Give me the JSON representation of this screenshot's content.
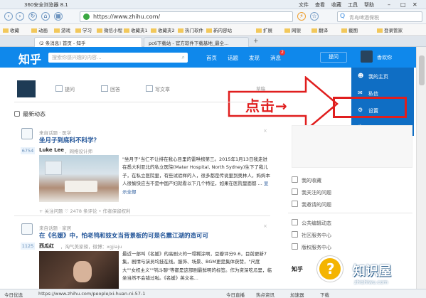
{
  "browser": {
    "title": "360安全浏览器 8.1",
    "menus": [
      "文件",
      "查看",
      "收藏",
      "工具",
      "帮助"
    ],
    "url": "https://www.zhihu.com/",
    "search_placeholder": "青岛啤酒保税",
    "favorites": [
      "收藏",
      "动画",
      "游戏",
      "学习",
      "微信小程",
      "收藏夹1",
      "收藏夹2",
      "热门软件",
      "新内容站",
      "扩展",
      "网银",
      "翻译",
      "截图",
      "登录管家"
    ],
    "tabs": [
      {
        "label": "(2 条消息) 首页 - 知乎",
        "active": true
      },
      {
        "label": "pc6下载站 - 官方软件下载基地_最全...",
        "active": false
      }
    ]
  },
  "zhihu": {
    "logo": "知乎",
    "search_placeholder": "搜索你感兴趣的内容...",
    "nav": [
      "首页",
      "话题",
      "发现",
      "消息"
    ],
    "message_badge": "2",
    "ask_button": "提问",
    "username": "香欢你",
    "menu": [
      {
        "label": "我的主页",
        "icon": "person-icon"
      },
      {
        "label": "私信",
        "icon": "envelope-icon"
      },
      {
        "label": "设置",
        "icon": "gear-icon"
      },
      {
        "label": "退出",
        "icon": "power-icon"
      }
    ],
    "annotation_label": "点击→",
    "actions": [
      "提问",
      "回答",
      "写文章"
    ],
    "drafts": "草稿",
    "feed_header": "最新动态",
    "feed": [
      {
        "from": "来自话题 · 医学",
        "count": "6754",
        "title": "坐月子到底科不科学？",
        "author": "Luke Lee",
        "signature": "，网络设计师",
        "body": "\"坐月子\"当仁不让排在我心目里的雷哄榜第三。2015年1月13日我走进在悉大利亚北的私立医院(Mater Hospital, North Sydney)生下了我儿子，在私立医院里，有些试验样的人，很多都是传说里到奥林人，妈妈本人很愉快应当不是中国产妇就看以下几个特征，如果在医院里面都 ...",
        "read_all": "显示全部",
        "footer": "+ 关注问题  ♡ 2478 条评论  • 作者保留权利"
      },
      {
        "from": "来自话题 · 家居",
        "count": "1125",
        "title": "在《名媛》中，怕老鸨和妓女当背景板的可是名震江湖的造可可",
        "author": "西瓜红",
        "signature": "，淘气美家辣，微博：xgjiaju",
        "body": "最近一部叫《名媛》的高剧火的一塌糊涂啊，豆瓣评分9.6，目前更新7集，剧情与演员均挂在线。服饰、场景、BGM更是集体获赞，\"尺度大\"\"女权主义\"\"鸨斗聊\"等都是这部剧最鲜明的标签。作为资深吃瓜里，临坐当然不会错过啦。《名媛》英文名..."
      }
    ],
    "right_links": [
      "我的收藏",
      "我关注的问题",
      "我邀请的问题",
      "公共编辑动态",
      "社区服务中心",
      "版权服务中心"
    ],
    "right_title": "知乎"
  },
  "watermark": {
    "text": "知识屋",
    "sub": "zhishiwu.com"
  },
  "status": {
    "left": "今日优选",
    "url": "https://www.zhihu.com/people/xi-huan-ni-57-1",
    "items": [
      "今日直播",
      "热点资讯",
      "加速器",
      "下载"
    ]
  }
}
